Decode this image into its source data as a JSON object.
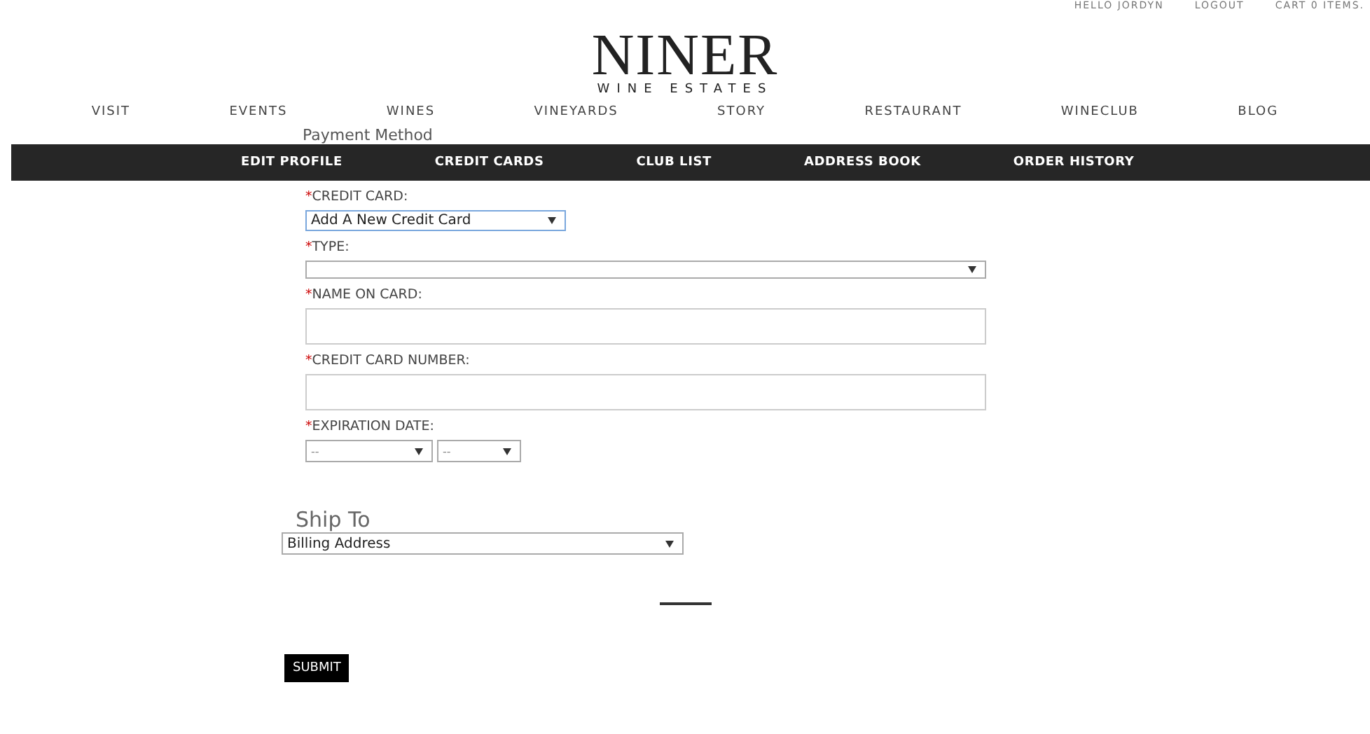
{
  "top_links": [
    "HELLO JORDYN",
    "LOGOUT",
    "CART 0 ITEMS."
  ],
  "logo": {
    "name": "NINER",
    "tagline": "WINE ESTATES"
  },
  "main_nav": [
    "VISIT",
    "EVENTS",
    "WINES",
    "VINEYARDS",
    "STORY",
    "RESTAURANT",
    "WINECLUB",
    "BLOG"
  ],
  "account_nav": [
    {
      "label": "EDIT PROFILE",
      "selected": false
    },
    {
      "label": "CREDIT CARDS",
      "selected": false
    },
    {
      "label": "CLUB LIST",
      "selected": false
    },
    {
      "label": "ADDRESS BOOK",
      "selected": false
    },
    {
      "label": "ORDER HISTORY",
      "selected": false
    }
  ],
  "payment_heading": "Payment Method",
  "fields": [
    {
      "kind": "short_select",
      "required_mark": "*",
      "label": "CREDIT CARD:",
      "value": "Add A New Credit Card"
    },
    {
      "kind": "wide_select",
      "required_mark": "*",
      "label": "TYPE:"
    },
    {
      "kind": "text",
      "required_mark": "*",
      "label": "NAME ON CARD:"
    },
    {
      "kind": "text",
      "required_mark": "*",
      "label": "CREDIT CARD NUMBER:"
    },
    {
      "kind": "date",
      "required_mark": "*",
      "label": "EXPIRATION DATE:",
      "month": "--",
      "year": "--"
    }
  ],
  "ship_to": {
    "heading": "Ship To",
    "value": "Billing Address"
  },
  "submit": "SUBMIT"
}
